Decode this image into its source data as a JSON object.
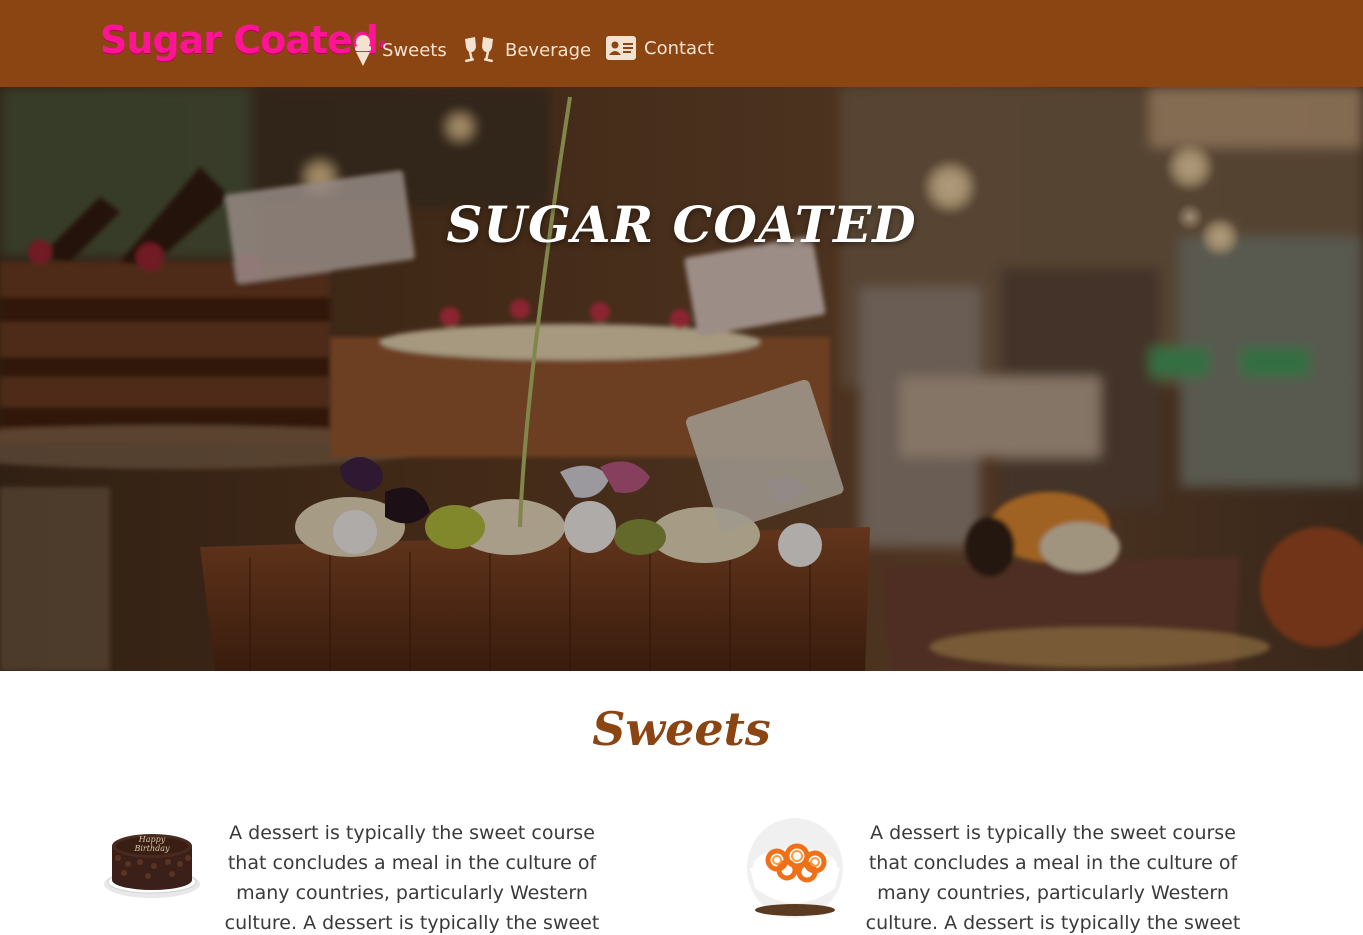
{
  "nav": {
    "brand": "Sugar Coated",
    "brand_mark": "®",
    "links": [
      {
        "label": "Sweets",
        "icon": "ice-cream-icon"
      },
      {
        "label": "Beverage",
        "icon": "glasses-cheers-icon"
      },
      {
        "label": "Contact",
        "icon": "address-card-icon"
      }
    ]
  },
  "hero": {
    "title": "SUGAR COATED"
  },
  "sweets": {
    "title": "Sweets",
    "items": [
      {
        "image": "birthday-cake",
        "cake_text": "Happy Birthday",
        "description": "A dessert is typically the sweet course that concludes a meal in the culture of many countries, particularly Western culture. A dessert is typically the sweet course that"
      },
      {
        "image": "jalebi-bowl",
        "description": "A dessert is typically the sweet course that concludes a meal in the culture of many countries, particularly Western culture. A dessert is typically the sweet course that"
      }
    ]
  },
  "colors": {
    "navbar": "#8b4513",
    "brand": "#ff1493",
    "nav_text": "#f2e2cf",
    "section_title": "#8b4513",
    "body_text": "#3a3a3a"
  }
}
